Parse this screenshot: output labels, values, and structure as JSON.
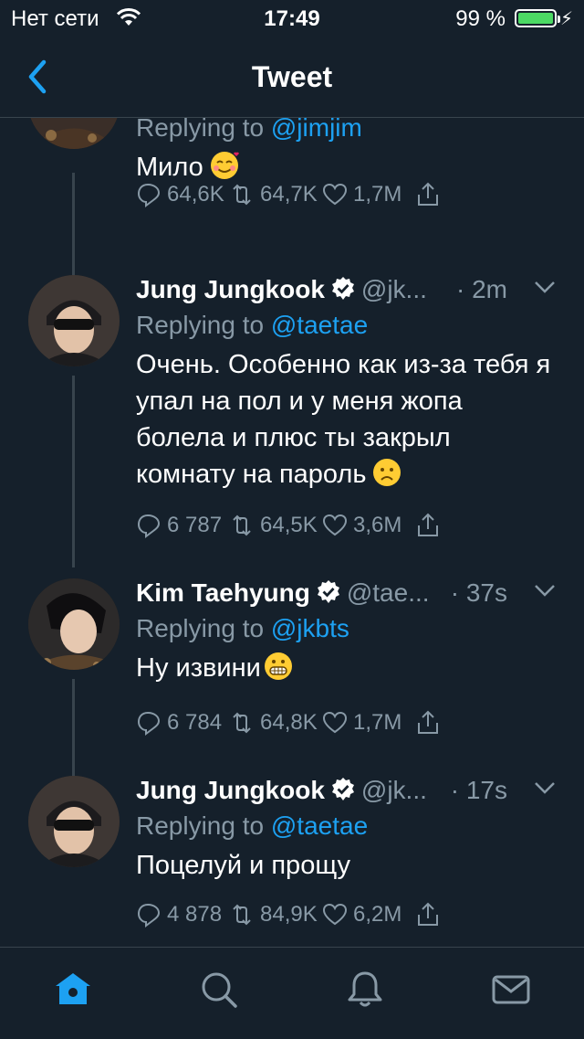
{
  "status_bar": {
    "carrier": "Нет сети",
    "time": "17:49",
    "battery_percent": "99 %",
    "battery_level": 0.99,
    "wifi_icon": "wifi-icon"
  },
  "nav": {
    "title": "Tweet",
    "back_icon": "chevron-left-icon"
  },
  "tweets": [
    {
      "replying_prefix": "Replying to",
      "replying_handle": "@jimjim",
      "text": "Мило",
      "emoji": "smiling-face-with-hearts",
      "replies": "64,6K",
      "retweets": "64,7K",
      "likes": "1,7M"
    },
    {
      "name": "Jung Jungkook",
      "handle": "@jk...",
      "time": "· 2m",
      "replying_prefix": "Replying to",
      "replying_handle": "@taetae",
      "text": "Очень. Особенно как из-за тебя я упал на пол и у меня жопа болела и плюс ты закрыл комнату на пароль",
      "emoji": "frowning-face",
      "replies": "6 787",
      "retweets": "64,5K",
      "likes": "3,6M"
    },
    {
      "name": "Kim Taehyung",
      "handle": "@tae...",
      "time": "· 37s",
      "replying_prefix": "Replying to",
      "replying_handle": "@jkbts",
      "text": "Ну извини",
      "emoji": "grimacing-face",
      "replies": "6 784",
      "retweets": "64,8K",
      "likes": "1,7M"
    },
    {
      "name": "Jung Jungkook",
      "handle": "@jk...",
      "time": "· 17s",
      "replying_prefix": "Replying to",
      "replying_handle": "@taetae",
      "text": "Поцелуй и прощу",
      "replies": "4 878",
      "retweets": "84,9K",
      "likes": "6,2M"
    }
  ],
  "tab_bar": {
    "items": [
      "home-icon",
      "search-icon",
      "notifications-icon",
      "messages-icon"
    ],
    "active": "home-icon",
    "accent": "#1da1f2"
  },
  "colors": {
    "background": "#15202b",
    "secondary_text": "#8899a6",
    "link": "#1da1f2",
    "divider": "#38444d"
  }
}
